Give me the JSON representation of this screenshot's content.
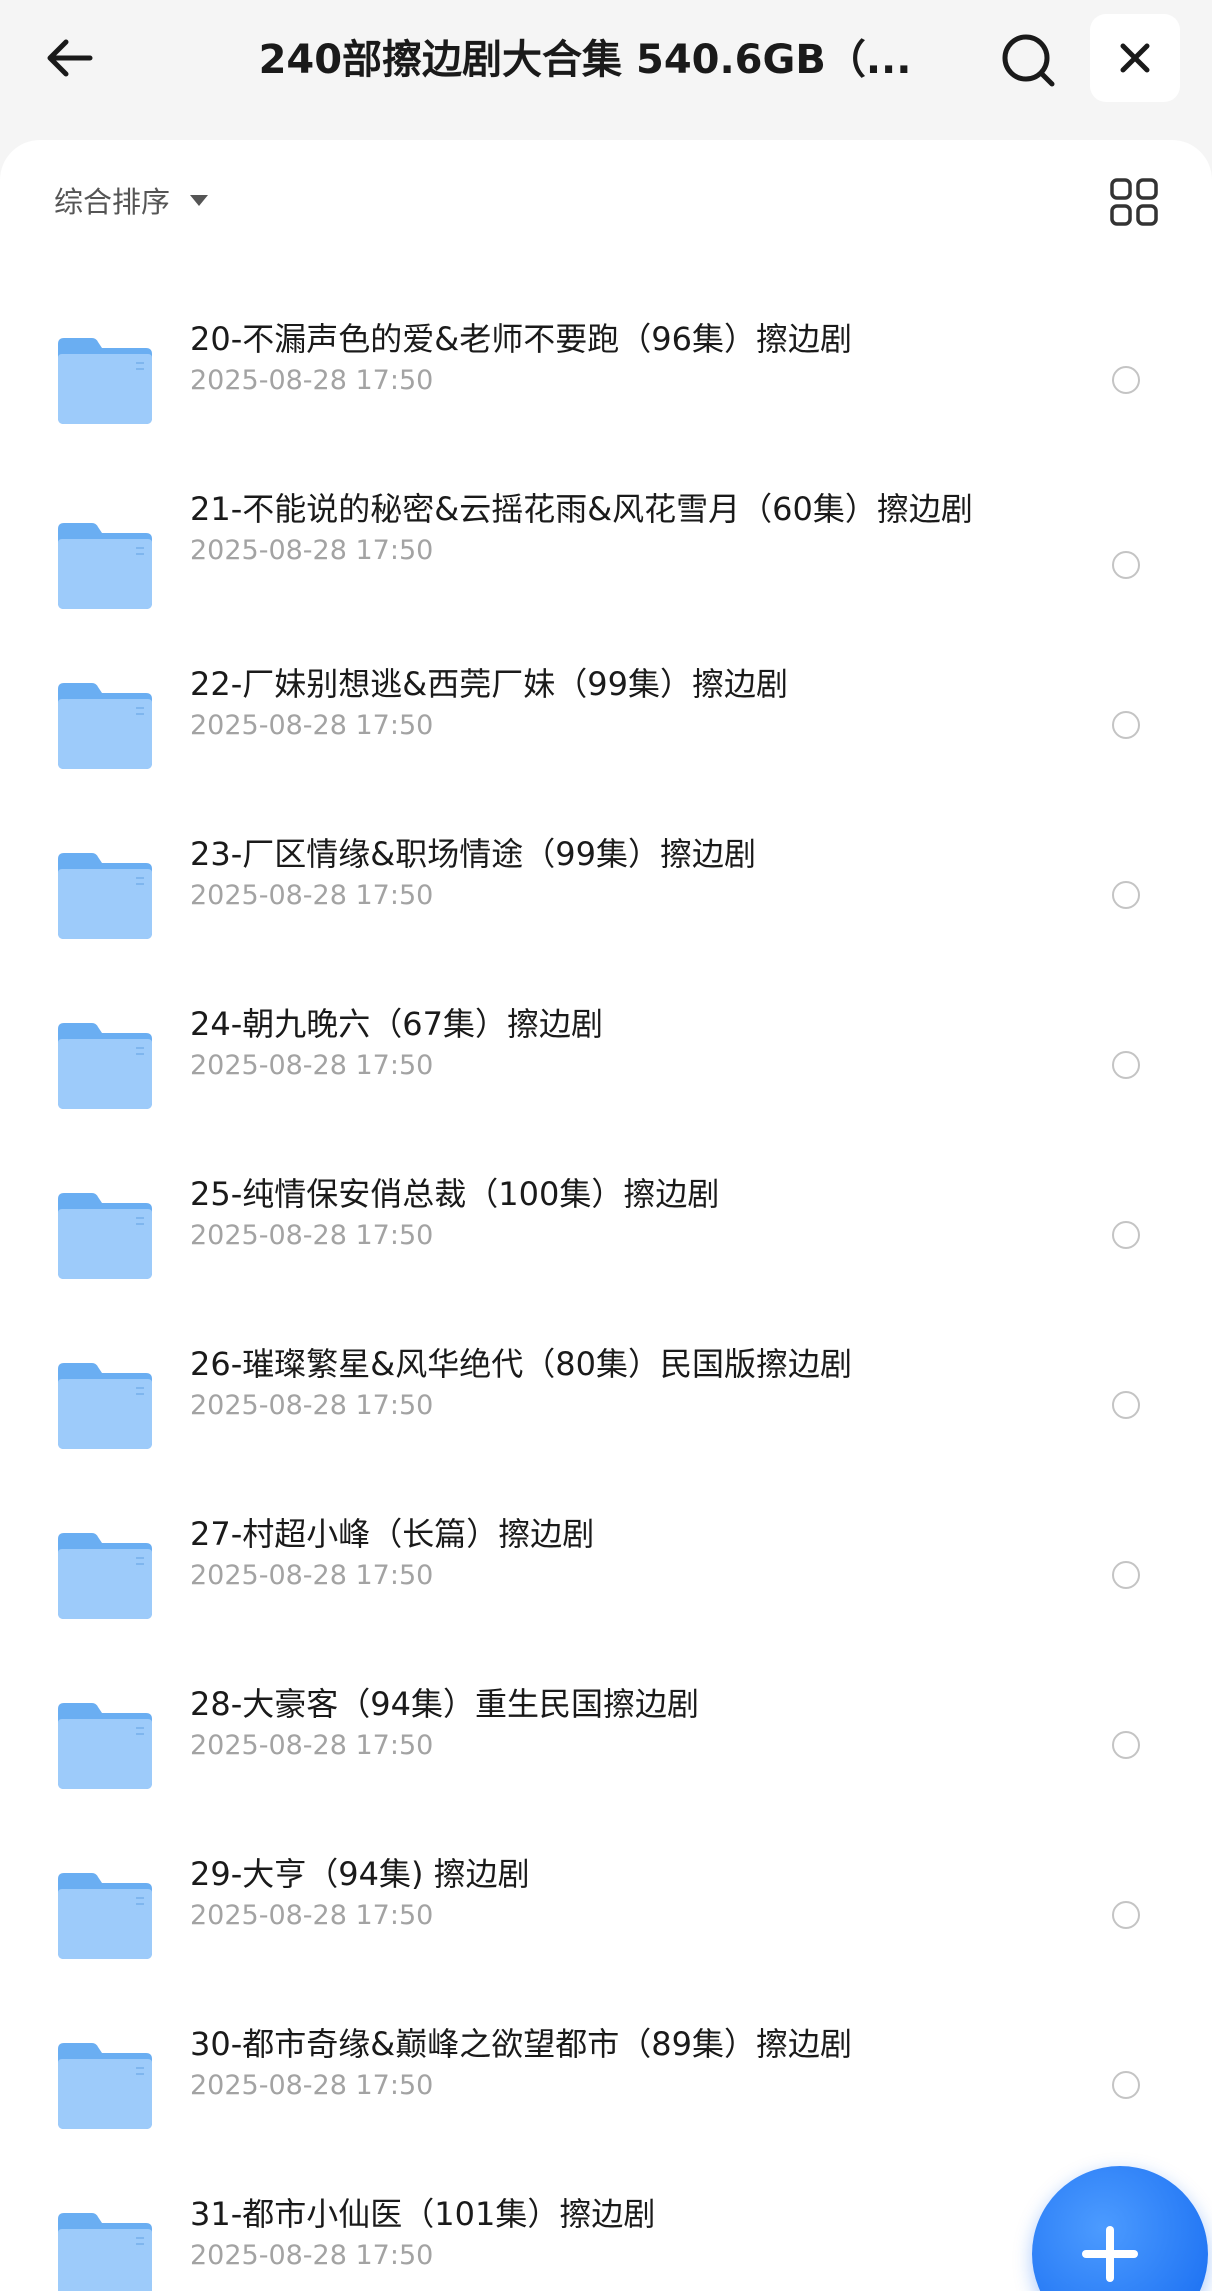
{
  "header": {
    "title": "240部擦边剧大合集 540.6GB（...",
    "back_icon": "arrow-left-icon",
    "search_icon": "search-icon",
    "close_icon": "close-icon"
  },
  "toolbar": {
    "sort_label": "综合排序",
    "sort_icon": "caret-down-icon",
    "view_icon": "grid-view-icon"
  },
  "colors": {
    "folder": "#7db8f5",
    "accent": "#1268f0",
    "date": "#a3a3a3"
  },
  "files": [
    {
      "name": "20-不漏声色的爱&老师不要跑（96集）擦边剧",
      "date": "2025-08-28 17:50"
    },
    {
      "name": "21-不能说的秘密&云摇花雨&风花雪月（60集）擦边剧",
      "date": "2025-08-28 17:50"
    },
    {
      "name": "22-厂妹别想逃&西莞厂妹（99集）擦边剧",
      "date": "2025-08-28 17:50"
    },
    {
      "name": "23-厂区情缘&职场情途（99集）擦边剧",
      "date": "2025-08-28 17:50"
    },
    {
      "name": "24-朝九晚六（67集）擦边剧",
      "date": "2025-08-28 17:50"
    },
    {
      "name": "25-纯情保安俏总裁（100集）擦边剧",
      "date": "2025-08-28 17:50"
    },
    {
      "name": "26-璀璨繁星&风华绝代（80集）民国版擦边剧",
      "date": "2025-08-28 17:50"
    },
    {
      "name": "27-村超小峰（长篇）擦边剧",
      "date": "2025-08-28 17:50"
    },
    {
      "name": "28-大豪客（94集）重生民国擦边剧",
      "date": "2025-08-28 17:50"
    },
    {
      "name": "29-大亨（94集) 擦边剧",
      "date": "2025-08-28 17:50"
    },
    {
      "name": "30-都市奇缘&巅峰之欲望都市（89集）擦边剧",
      "date": "2025-08-28 17:50"
    },
    {
      "name": "31-都市小仙医（101集）擦边剧",
      "date": "2025-08-28 17:50"
    }
  ],
  "fab_icon": "plus-icon"
}
